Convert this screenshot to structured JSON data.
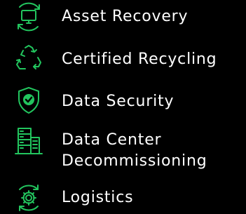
{
  "accent_color": "#22c55e",
  "text_color": "#ffffff",
  "background_color": "#000000",
  "items": [
    {
      "label": "Asset Recovery",
      "icon": "monitor-cycle-icon"
    },
    {
      "label": "Certified Recycling",
      "icon": "recycle-icon"
    },
    {
      "label": "Data Security",
      "icon": "shield-check-icon"
    },
    {
      "label_line1": "Data Center",
      "label_line2": "Decommissioning",
      "icon": "server-building-icon"
    },
    {
      "label": "Logistics",
      "icon": "gear-cycle-icon"
    }
  ]
}
